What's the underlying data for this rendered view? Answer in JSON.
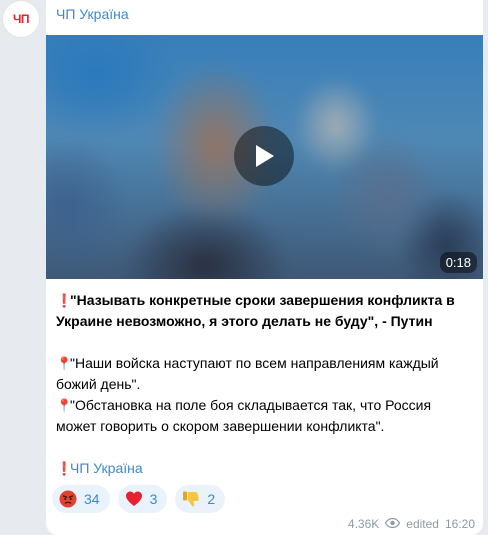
{
  "channel": {
    "avatar_text": "ЧП",
    "name": "ЧП Україна"
  },
  "video": {
    "duration": "0:18",
    "play_icon": "play-icon"
  },
  "message": {
    "line1": "\"Называть конкретные сроки завершения конфликта в Украине невозможно, я этого делать не буду\", - Путин",
    "line2": "\"Наши войска наступают по всем направлениям каждый божий день\".",
    "line3": "\"Обстановка на поле боя складывается так, что Россия может говорить о скором завершении конфликта\".",
    "signature": "ЧП Україна"
  },
  "reactions": [
    {
      "icon": "angry-face-icon",
      "count": "34"
    },
    {
      "icon": "red-heart-icon",
      "count": "3"
    },
    {
      "icon": "thumbs-down-icon",
      "count": "2"
    }
  ],
  "footer": {
    "views": "4.36K",
    "edited": "edited",
    "time": "16:20"
  },
  "colors": {
    "link": "#3a8ad0",
    "accent_red": "#e3262c",
    "background": "#e7ebf0"
  }
}
